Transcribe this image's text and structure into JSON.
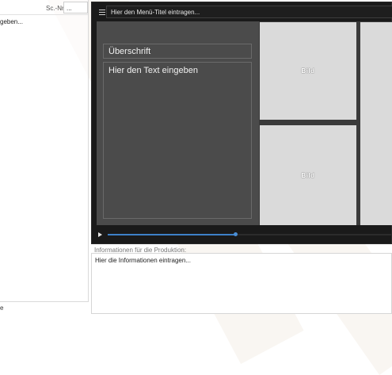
{
  "left_panel": {
    "scene_number_label": "Sc.-Nr.:",
    "scene_number_value": "...",
    "text_fragment": "geben...",
    "bottom_fragment": "e"
  },
  "player": {
    "menu_title_placeholder": "Hier den Menü-Titel eintragen...",
    "heading": "Überschrift",
    "body_text": "Hier den Text eingeben",
    "image_label": "Bild",
    "progress": 0.45
  },
  "production_info": {
    "label": "Informationen für die Produktion:",
    "value": "Hier die Informationen eintragen..."
  },
  "colors": {
    "player_bg": "#1a1a1a",
    "text_panel": "#4b4b4b",
    "image_placeholder": "#dadada",
    "progress_accent": "#3d80c8"
  }
}
